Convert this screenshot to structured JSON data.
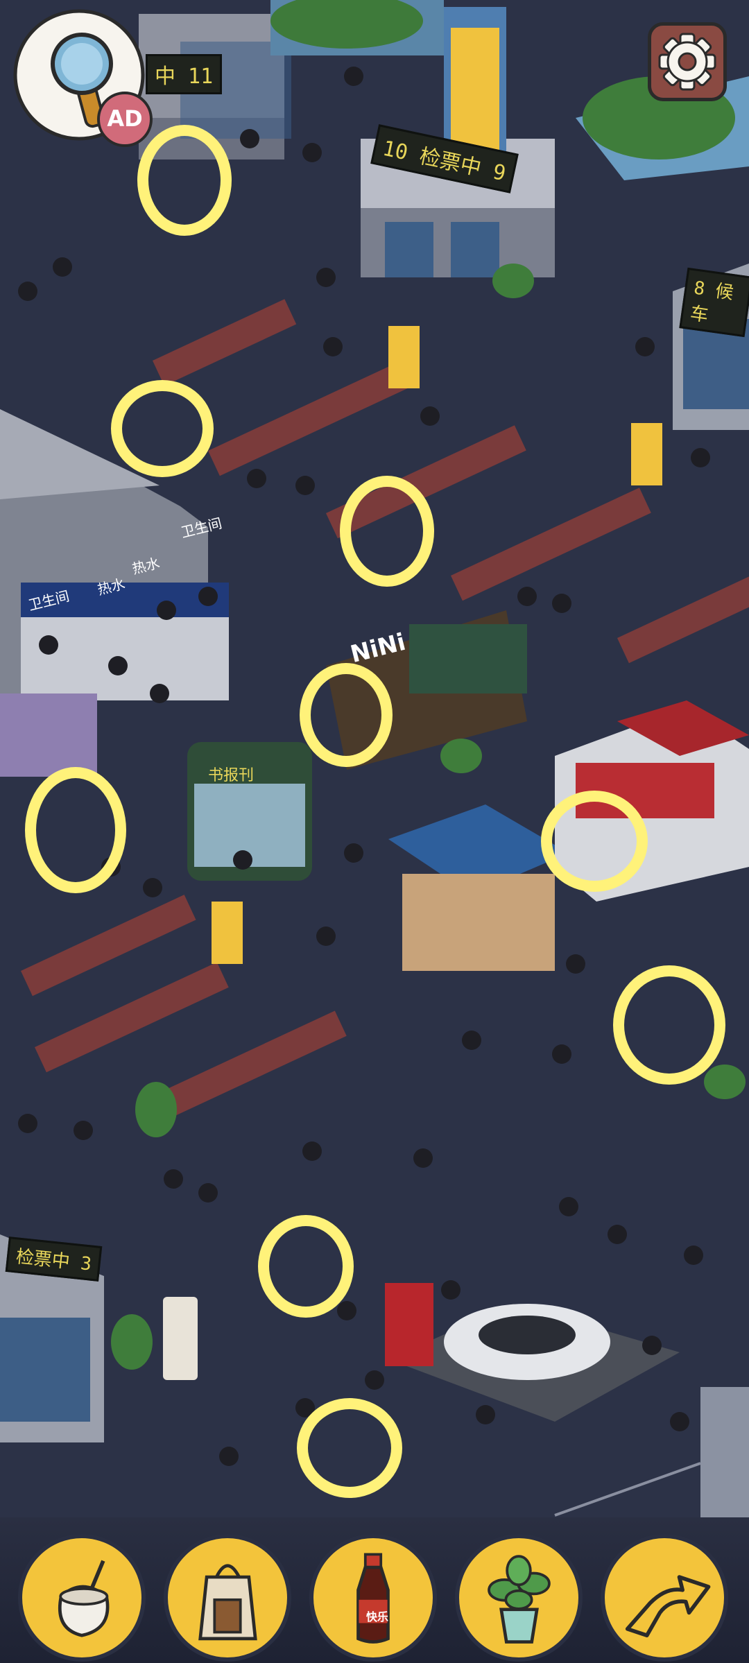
{
  "hud": {
    "hint_button": {
      "icon": "magnifier-icon",
      "badge": "AD"
    },
    "settings_button": {
      "icon": "gear-icon"
    }
  },
  "scene": {
    "signs": {
      "gate_11": "中 11",
      "gate_10": "10  检票中 9",
      "gate_8": "8  候车",
      "gate_3": "检票中 3",
      "restroom_1": "卫生间",
      "restroom_2": "卫生间",
      "hot_water_1": "热水",
      "hot_water_2": "热水",
      "cafe": "NiNi",
      "book_kiosk": "书报刊"
    }
  },
  "found_markers": [
    {
      "id": "marker-trash-bin"
    },
    {
      "id": "marker-seat-item"
    },
    {
      "id": "marker-bench-item"
    },
    {
      "id": "marker-cafe-item"
    },
    {
      "id": "marker-left-item"
    },
    {
      "id": "marker-shop-item"
    },
    {
      "id": "marker-cart-item"
    },
    {
      "id": "marker-bottle-item"
    },
    {
      "id": "marker-arrow-item"
    }
  ],
  "items_bar": [
    {
      "icon": "coconut-drink-icon"
    },
    {
      "icon": "shopping-bag-icon"
    },
    {
      "icon": "soda-bottle-icon",
      "label": "快乐"
    },
    {
      "icon": "potted-plant-icon"
    },
    {
      "icon": "curved-arrow-icon"
    }
  ],
  "colors": {
    "floor": "#2c3247",
    "marker": "#fff27a",
    "item_slot": "#f3c43b",
    "seat_red": "#7a3b3b"
  }
}
